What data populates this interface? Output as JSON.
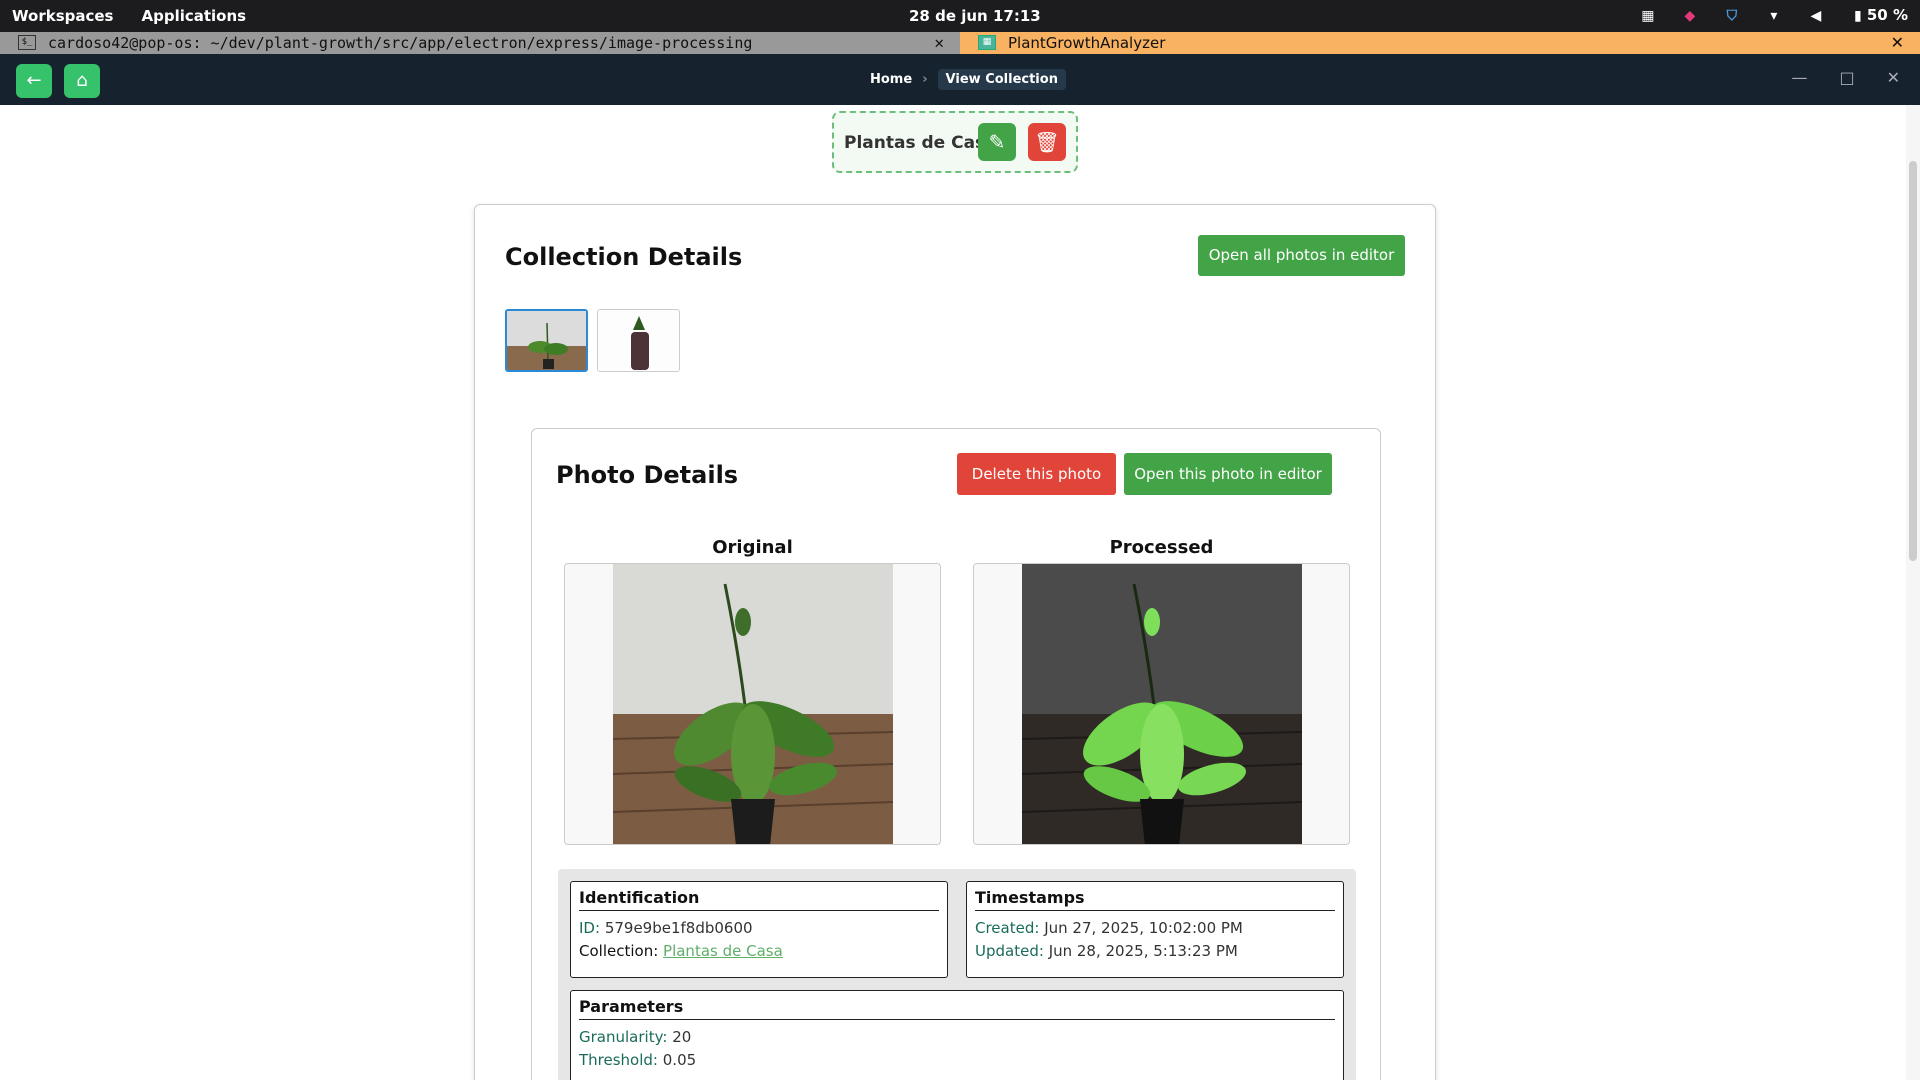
{
  "os": {
    "workspaces": "Workspaces",
    "applications": "Applications",
    "clock": "28 de jun  17:13",
    "battery": "50 %"
  },
  "tabs": {
    "terminal": "cardoso42@pop-os: ~/dev/plant-growth/src/app/electron/express/image-processing",
    "app": "PlantGrowthAnalyzer"
  },
  "nav": {
    "crumbs": [
      "Home",
      "View Collection"
    ],
    "separator": "›"
  },
  "collection": {
    "name": "Plantas de Casa",
    "title": "Collection Details",
    "open_all": "Open all photos in editor"
  },
  "photo": {
    "title": "Photo Details",
    "delete": "Delete this photo",
    "open": "Open this photo in editor",
    "original": "Original",
    "processed": "Processed"
  },
  "identification": {
    "title": "Identification",
    "id_label": "ID:",
    "id_value": "579e9be1f8db0600",
    "collection_label": "Collection:",
    "collection_value": "Plantas de Casa"
  },
  "timestamps": {
    "title": "Timestamps",
    "created_label": "Created:",
    "created_value": "Jun 27, 2025, 10:02:00 PM",
    "updated_label": "Updated:",
    "updated_value": "Jun 28, 2025, 5:13:23 PM"
  },
  "parameters": {
    "title": "Parameters",
    "granularity_label": "Granularity:",
    "granularity_value": "20",
    "threshold_label": "Threshold:",
    "threshold_value": "0.05"
  },
  "colors": {
    "accent_green": "#43a447",
    "danger_red": "#e14439",
    "appbar": "#16232e"
  }
}
